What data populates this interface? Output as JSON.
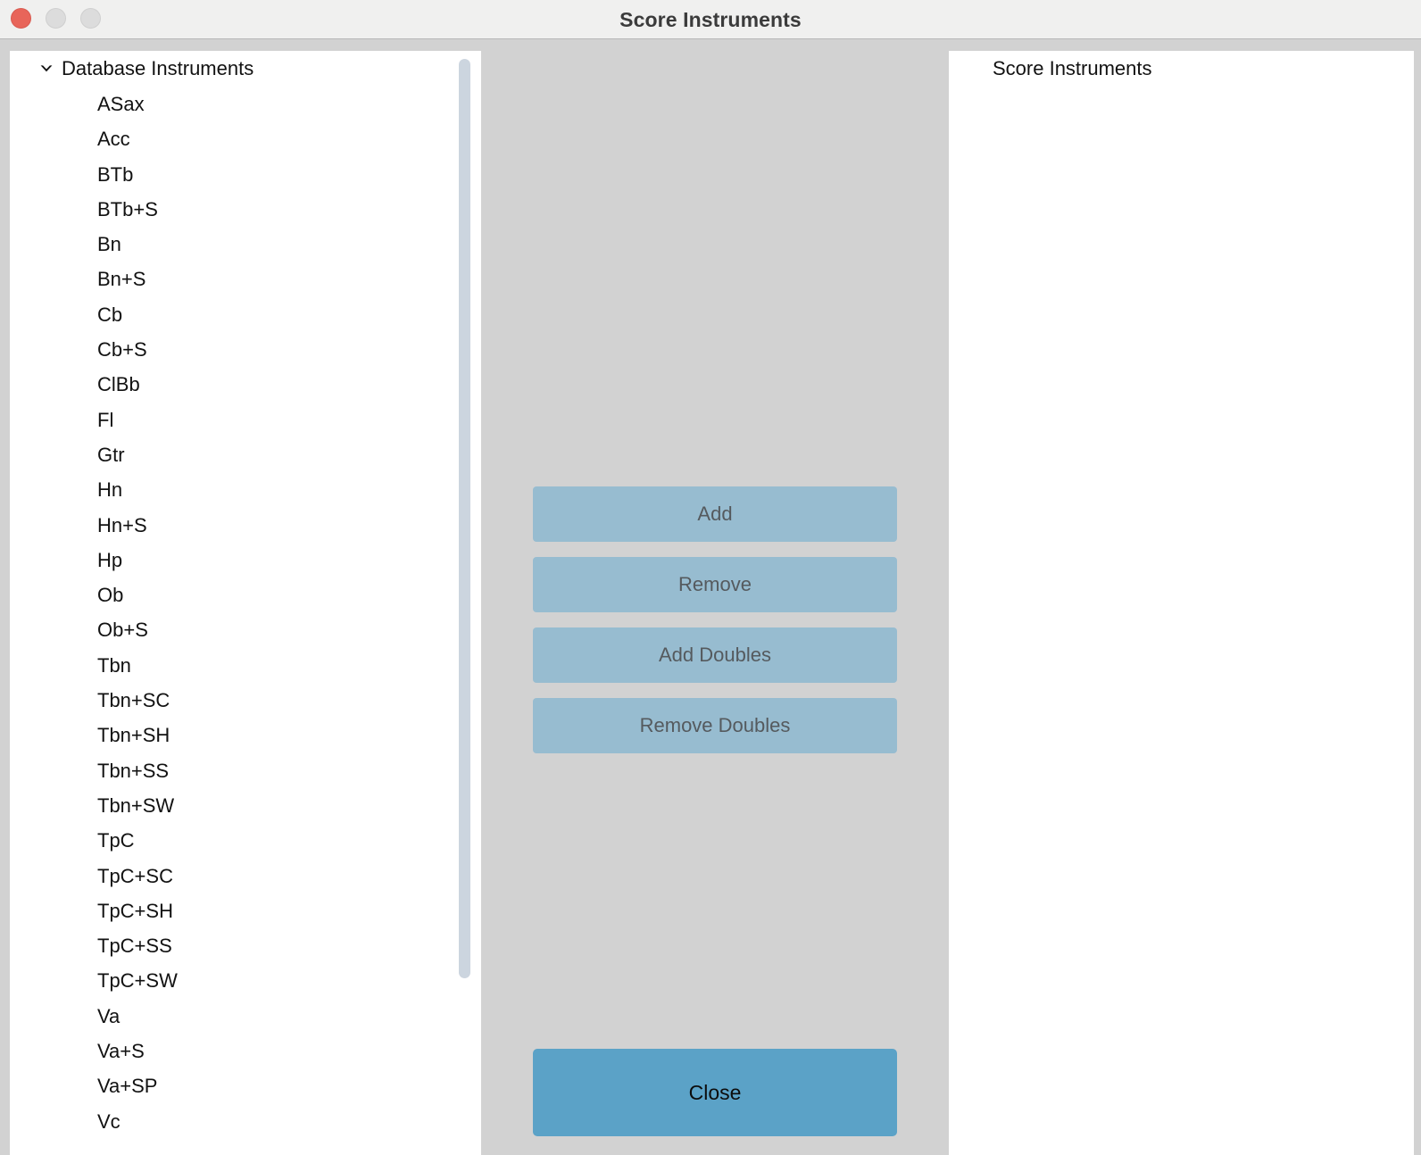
{
  "window": {
    "title": "Score Instruments",
    "traffic_lights": [
      {
        "name": "close",
        "color": "#e8655a"
      },
      {
        "name": "minimize",
        "color": "#dcdcdc"
      },
      {
        "name": "zoom",
        "color": "#dcdcdc"
      }
    ]
  },
  "database_panel": {
    "root_label": "Database Instruments",
    "expanded": true,
    "chevron_icon": "chevron-down-icon",
    "items": [
      "ASax",
      "Acc",
      "BTb",
      "BTb+S",
      "Bn",
      "Bn+S",
      "Cb",
      "Cb+S",
      "ClBb",
      "Fl",
      "Gtr",
      "Hn",
      "Hn+S",
      "Hp",
      "Ob",
      "Ob+S",
      "Tbn",
      "Tbn+SC",
      "Tbn+SH",
      "Tbn+SS",
      "Tbn+SW",
      "TpC",
      "TpC+SC",
      "TpC+SH",
      "TpC+SS",
      "TpC+SW",
      "Va",
      "Va+S",
      "Va+SP",
      "Vc"
    ]
  },
  "actions": {
    "add_label": "Add",
    "remove_label": "Remove",
    "add_doubles_label": "Add Doubles",
    "remove_doubles_label": "Remove Doubles",
    "close_label": "Close",
    "enabled_color": "#5ba2c7",
    "disabled_color": "#97bcd0"
  },
  "score_panel": {
    "root_label": "Score Instruments",
    "items": []
  }
}
